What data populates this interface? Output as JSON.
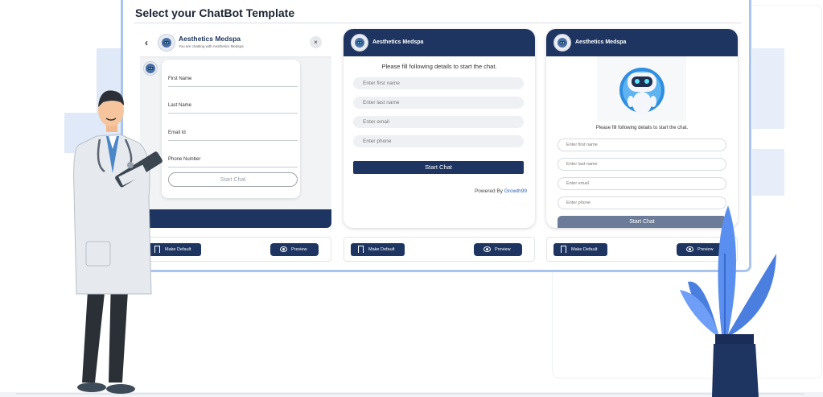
{
  "page": {
    "title": "Select your ChatBot Template"
  },
  "colors": {
    "navy": "#1e3561",
    "frame_border": "#a9c4ee",
    "link": "#2b5fb6"
  },
  "template1": {
    "back_icon": "chevron-left-icon",
    "bot_name": "Aesthetics Medspa",
    "subtitle": "You are chatting with Aesthetics Medspa",
    "close_icon": "close-icon",
    "close_glyph": "×",
    "back_glyph": "‹",
    "fields": [
      "First Name",
      "Last Name",
      "Email Id",
      "Phone Number"
    ],
    "start_label": "Start Chat"
  },
  "template2": {
    "bot_name": "Aesthetics Medspa",
    "instruction": "Please fill following details to start the chat.",
    "placeholders": [
      "Enter first name",
      "Enter last name",
      "Enter email",
      "Enter phone"
    ],
    "start_label": "Start Chat",
    "powered_by_prefix": "Powered By ",
    "powered_by_brand": "Growth99"
  },
  "template3": {
    "bot_name": "Aesthetics Medspa",
    "bot_image_icon": "robot-icon",
    "instruction": "Please fill following details to start the chat.",
    "placeholders": [
      "Enter first name",
      "Enter last name",
      "Enter email",
      "Enter phone"
    ],
    "start_label": "Start Chat"
  },
  "actions": {
    "make_default_label": "Make Default",
    "make_default_icon": "bookmark-icon",
    "preview_label": "Preview",
    "preview_icon": "eye-icon"
  }
}
